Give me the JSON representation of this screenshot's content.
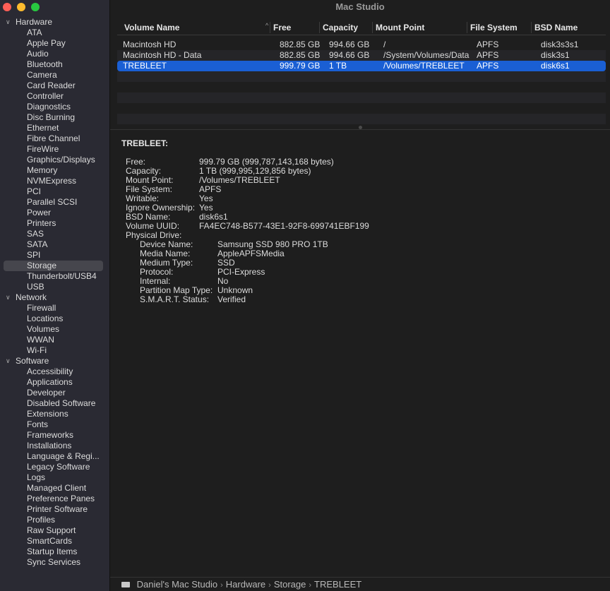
{
  "window": {
    "title": "Mac Studio"
  },
  "sidebar": {
    "sections": [
      {
        "label": "Hardware",
        "items": [
          "ATA",
          "Apple Pay",
          "Audio",
          "Bluetooth",
          "Camera",
          "Card Reader",
          "Controller",
          "Diagnostics",
          "Disc Burning",
          "Ethernet",
          "Fibre Channel",
          "FireWire",
          "Graphics/Displays",
          "Memory",
          "NVMExpress",
          "PCI",
          "Parallel SCSI",
          "Power",
          "Printers",
          "SAS",
          "SATA",
          "SPI",
          "Storage",
          "Thunderbolt/USB4",
          "USB"
        ]
      },
      {
        "label": "Network",
        "items": [
          "Firewall",
          "Locations",
          "Volumes",
          "WWAN",
          "Wi-Fi"
        ]
      },
      {
        "label": "Software",
        "items": [
          "Accessibility",
          "Applications",
          "Developer",
          "Disabled Software",
          "Extensions",
          "Fonts",
          "Frameworks",
          "Installations",
          "Language & Regi...",
          "Legacy Software",
          "Logs",
          "Managed Client",
          "Preference Panes",
          "Printer Software",
          "Profiles",
          "Raw Support",
          "SmartCards",
          "Startup Items",
          "Sync Services"
        ]
      }
    ],
    "selected": "Storage"
  },
  "table": {
    "columns": [
      "Volume Name",
      "Free",
      "Capacity",
      "Mount Point",
      "File System",
      "BSD Name"
    ],
    "sort_column": "Volume Name",
    "rows": [
      [
        "Macintosh HD",
        "882.85 GB",
        "994.66 GB",
        "/",
        "APFS",
        "disk3s3s1"
      ],
      [
        "Macintosh HD - Data",
        "882.85 GB",
        "994.66 GB",
        "/System/Volumes/Data",
        "APFS",
        "disk3s1"
      ],
      [
        "TREBLEET",
        "999.79 GB",
        "1 TB",
        "/Volumes/TREBLEET",
        "APFS",
        "disk6s1"
      ]
    ],
    "selected_row": 2
  },
  "detail": {
    "title": "TREBLEET:",
    "fields": [
      [
        "Free:",
        "999.79 GB (999,787,143,168 bytes)"
      ],
      [
        "Capacity:",
        "1 TB (999,995,129,856 bytes)"
      ],
      [
        "Mount Point:",
        "/Volumes/TREBLEET"
      ],
      [
        "File System:",
        "APFS"
      ],
      [
        "Writable:",
        "Yes"
      ],
      [
        "Ignore Ownership:",
        "Yes"
      ],
      [
        "BSD Name:",
        "disk6s1"
      ],
      [
        "Volume UUID:",
        "FA4EC748-B577-43E1-92F8-699741EBF199"
      ],
      [
        "Physical Drive:",
        ""
      ]
    ],
    "drive_fields": [
      [
        "Device Name:",
        "Samsung SSD 980 PRO 1TB"
      ],
      [
        "Media Name:",
        "AppleAPFSMedia"
      ],
      [
        "Medium Type:",
        "SSD"
      ],
      [
        "Protocol:",
        "PCI-Express"
      ],
      [
        "Internal:",
        "No"
      ],
      [
        "Partition Map Type:",
        "Unknown"
      ],
      [
        "S.M.A.R.T. Status:",
        "Verified"
      ]
    ]
  },
  "pathbar": [
    "Daniel's Mac Studio",
    "Hardware",
    "Storage",
    "TREBLEET"
  ],
  "colors": {
    "selection": "#1a5fd4",
    "sidebar_bg": "#2a2a33",
    "content_bg": "#1e1e1e"
  }
}
